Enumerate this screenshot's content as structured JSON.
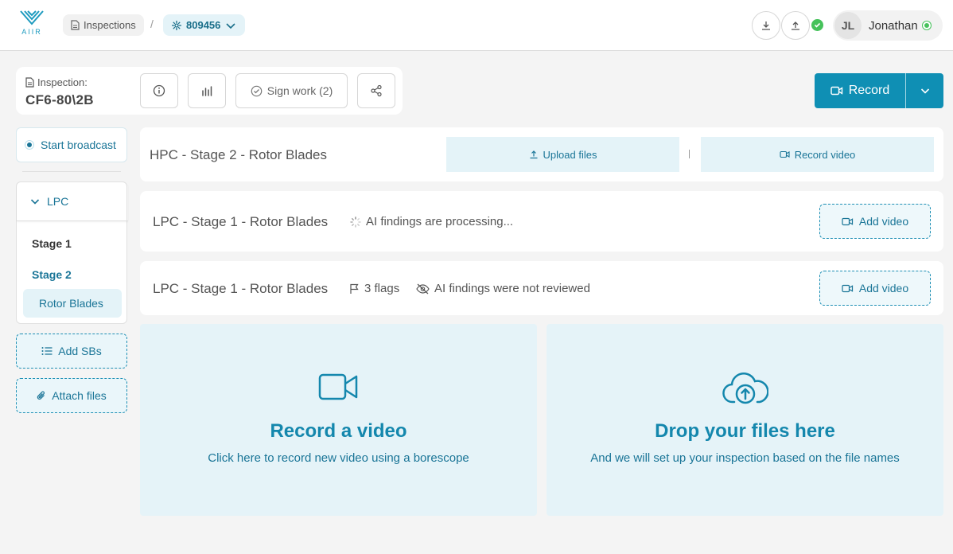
{
  "header": {
    "logo_text": "AIIR",
    "breadcrumb_inspections": "Inspections",
    "breadcrumb_separator": "/",
    "breadcrumb_engine": "809456",
    "user_initials": "JL",
    "user_name": "Jonathan"
  },
  "inspection": {
    "label": "Inspection:",
    "value": "CF6-80\\2B",
    "sign_work_label": "Sign work (2)",
    "record_label": "Record"
  },
  "sidebar": {
    "broadcast_label": "Start broadcast",
    "group_label": "LPC",
    "items": [
      {
        "label": "Stage 1"
      },
      {
        "label": "Stage 2"
      }
    ],
    "sub_item": "Rotor Blades",
    "add_sbs_label": "Add SBs",
    "attach_files_label": "Attach files"
  },
  "rows": [
    {
      "title": "HPC - Stage 2 - Rotor Blades",
      "upload_label": "Upload files",
      "record_video_label": "Record video"
    },
    {
      "title": "LPC - Stage 1 - Rotor Blades",
      "status": "AI findings are processing...",
      "add_video_label": "Add video"
    },
    {
      "title": "LPC - Stage 1 - Rotor Blades",
      "flags": "3 flags",
      "status": "AI findings were not reviewed",
      "add_video_label": "Add video"
    }
  ],
  "drop_record": {
    "title": "Record a video",
    "subtitle": "Click here to record new video using a borescope"
  },
  "drop_files": {
    "title": "Drop your files here",
    "subtitle": "And we will set up your inspection based on the file names"
  },
  "colors": {
    "accent": "#0f8fb4",
    "accent_light": "#e4f3f8",
    "online": "#46c25b"
  }
}
